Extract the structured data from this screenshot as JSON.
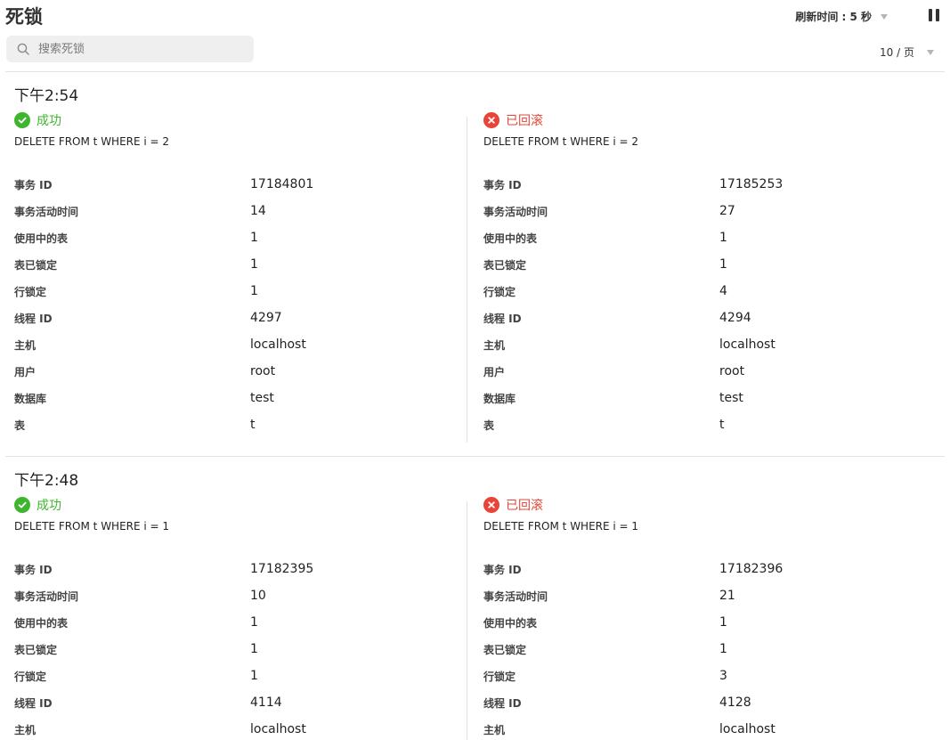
{
  "header": {
    "title": "死锁",
    "refresh_label": "刷新时间 : 5 秒",
    "search_placeholder": "搜索死锁",
    "per_page_label": "10 / 页"
  },
  "labels": {
    "txn_id": "事务 ID",
    "txn_active_time": "事务活动时间",
    "tables_in_use": "使用中的表",
    "tables_locked": "表已锁定",
    "row_locks": "行锁定",
    "thread_id": "线程 ID",
    "host": "主机",
    "user": "用户",
    "database": "数据库",
    "table": "表"
  },
  "colors": {
    "success": "#3fb52f",
    "rolled_back": "#e8453a"
  },
  "deadlocks": [
    {
      "time": "下午2:54",
      "left": {
        "status": "成功",
        "query": "DELETE FROM t WHERE i = 2",
        "txn_id": "17184801",
        "txn_active_time": "14",
        "tables_in_use": "1",
        "tables_locked": "1",
        "row_locks": "1",
        "thread_id": "4297",
        "host": "localhost",
        "user": "root",
        "database": "test",
        "table": "t"
      },
      "right": {
        "status": "已回滚",
        "query": "DELETE FROM t WHERE i = 2",
        "txn_id": "17185253",
        "txn_active_time": "27",
        "tables_in_use": "1",
        "tables_locked": "1",
        "row_locks": "4",
        "thread_id": "4294",
        "host": "localhost",
        "user": "root",
        "database": "test",
        "table": "t"
      }
    },
    {
      "time": "下午2:48",
      "left": {
        "status": "成功",
        "query": "DELETE FROM t WHERE i = 1",
        "txn_id": "17182395",
        "txn_active_time": "10",
        "tables_in_use": "1",
        "tables_locked": "1",
        "row_locks": "1",
        "thread_id": "4114",
        "host": "localhost"
      },
      "right": {
        "status": "已回滚",
        "query": "DELETE FROM t WHERE i = 1",
        "txn_id": "17182396",
        "txn_active_time": "21",
        "tables_in_use": "1",
        "tables_locked": "1",
        "row_locks": "3",
        "thread_id": "4128",
        "host": "localhost"
      }
    }
  ]
}
